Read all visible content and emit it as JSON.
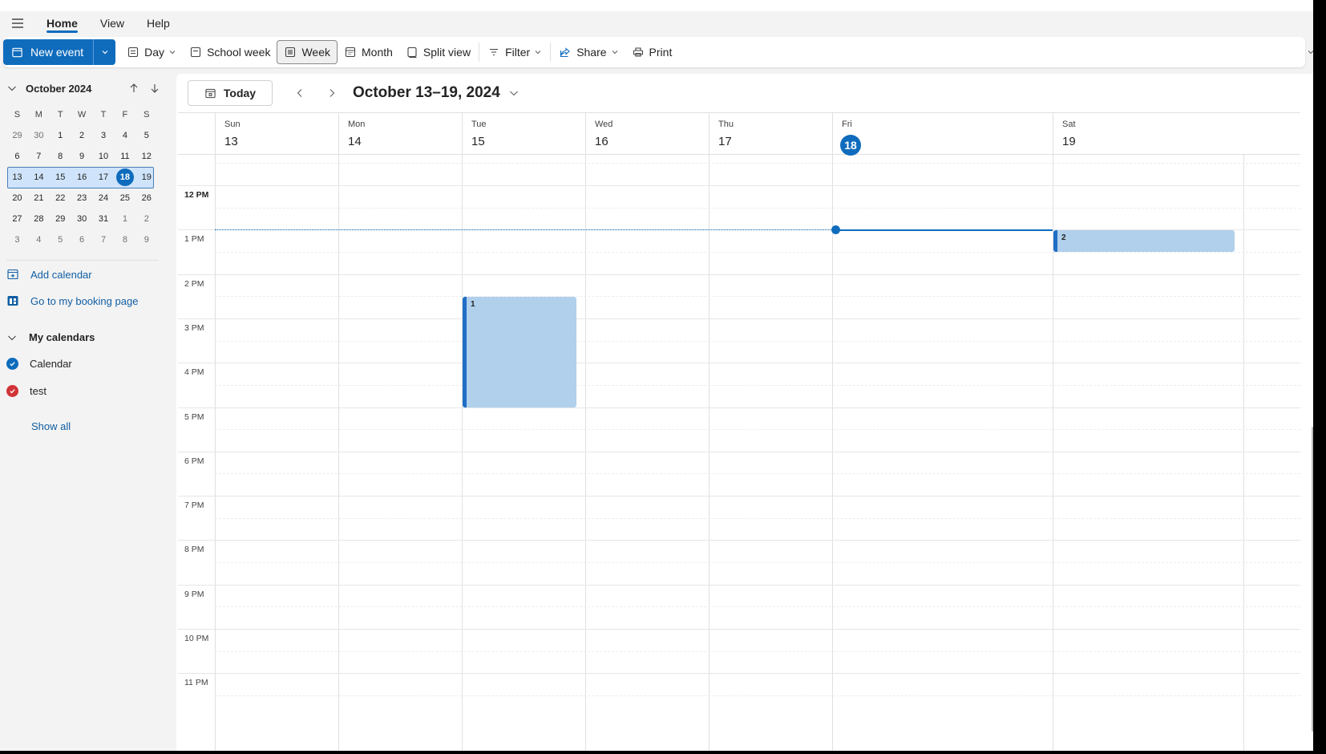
{
  "menubar": {
    "tabs": [
      {
        "label": "Home",
        "active": true
      },
      {
        "label": "View",
        "active": false
      },
      {
        "label": "Help",
        "active": false
      }
    ]
  },
  "ribbon": {
    "new_event": "New event",
    "day": "Day",
    "school_week": "School week",
    "week": "Week",
    "month": "Month",
    "split_view": "Split view",
    "filter": "Filter",
    "share": "Share",
    "print": "Print",
    "selected_view": "Week"
  },
  "mini_calendar": {
    "month_label": "October 2024",
    "weekdays": [
      "S",
      "M",
      "T",
      "W",
      "T",
      "F",
      "S"
    ],
    "weeks": [
      [
        "29",
        "30",
        "1",
        "2",
        "3",
        "4",
        "5"
      ],
      [
        "6",
        "7",
        "8",
        "9",
        "10",
        "11",
        "12"
      ],
      [
        "13",
        "14",
        "15",
        "16",
        "17",
        "18",
        "19"
      ],
      [
        "20",
        "21",
        "22",
        "23",
        "24",
        "25",
        "26"
      ],
      [
        "27",
        "28",
        "29",
        "30",
        "31",
        "1",
        "2"
      ],
      [
        "3",
        "4",
        "5",
        "6",
        "7",
        "8",
        "9"
      ]
    ],
    "selected_week_index": 2,
    "today": "18"
  },
  "left": {
    "add_calendar": "Add calendar",
    "booking_page": "Go to my booking page",
    "my_calendars": "My calendars",
    "calendars": [
      {
        "name": "Calendar",
        "color": "#0f6cbd"
      },
      {
        "name": "test",
        "color": "#d13438"
      }
    ],
    "show_all": "Show all"
  },
  "main": {
    "today_label": "Today",
    "range_title": "October 13–19, 2024",
    "days": [
      {
        "dow": "Sun",
        "num": "13",
        "today": false
      },
      {
        "dow": "Mon",
        "num": "14",
        "today": false
      },
      {
        "dow": "Tue",
        "num": "15",
        "today": false
      },
      {
        "dow": "Wed",
        "num": "16",
        "today": false
      },
      {
        "dow": "Thu",
        "num": "17",
        "today": false
      },
      {
        "dow": "Fri",
        "num": "18",
        "today": true
      },
      {
        "dow": "Sat",
        "num": "19",
        "today": false
      }
    ],
    "hours": [
      "12 PM",
      "1 PM",
      "2 PM",
      "3 PM",
      "4 PM",
      "5 PM",
      "6 PM",
      "7 PM",
      "8 PM",
      "9 PM",
      "10 PM",
      "11 PM"
    ],
    "events": [
      {
        "title": "1",
        "day_index": 2,
        "start_hour": 14.5,
        "end_hour": 17.0
      },
      {
        "title": "2",
        "day_index": 6,
        "start_hour": 13.0,
        "end_hour": 13.5
      }
    ],
    "current_time_hour": 13.0,
    "colors": {
      "accent": "#0f6cbd",
      "event_fill": "#b1d0ec",
      "event_border": "#1f6fc5"
    }
  }
}
